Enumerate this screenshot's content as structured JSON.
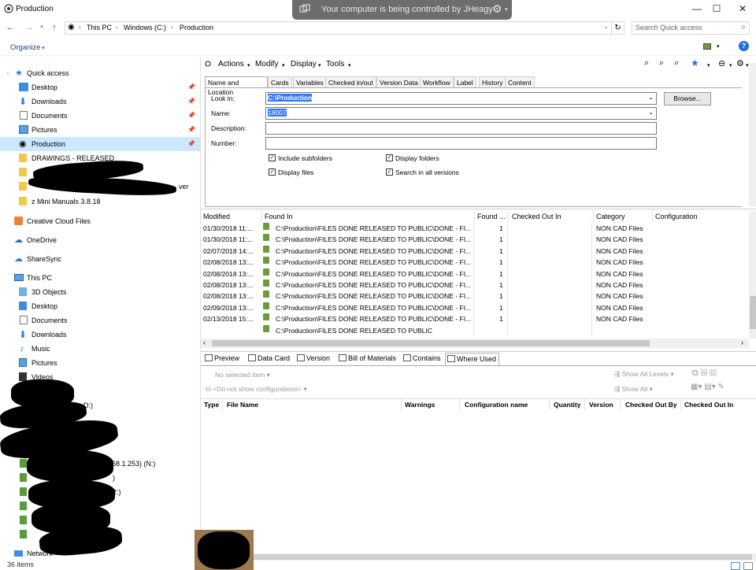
{
  "window": {
    "title": "Production",
    "control_banner": "Your computer is being controlled by JHeagy"
  },
  "address": {
    "crumbs": [
      "This PC",
      "Windows (C:)",
      "Production"
    ],
    "search_placeholder": "Search Quick access"
  },
  "toolbar": {
    "organize": "Organize"
  },
  "sidebar": {
    "quick_access": "Quick access",
    "qa_items": [
      "Desktop",
      "Downloads",
      "Documents",
      "Pictures",
      "Production",
      "DRAWINGS - RELEASED"
    ],
    "partial_overflow": "ver",
    "mini_manuals": "z Mini Manuals 3.8.18",
    "creative_cloud": "Creative Cloud Files",
    "onedrive": "OneDrive",
    "sharesync": "ShareSync",
    "this_pc": "This PC",
    "pc_items": [
      "3D Objects",
      "Desktop",
      "Documents",
      "Downloads",
      "Music",
      "Pictures",
      "Videos"
    ],
    "partial_drives": [
      ":)",
      "D:)",
      "68.1.253) (N:)",
      ")",
      "2:)"
    ],
    "network": "Network",
    "status_items": "36 items"
  },
  "vault": {
    "menu": [
      "Actions",
      "Modify",
      "Display",
      "Tools"
    ],
    "tabs": [
      "Name and Location",
      "Cards",
      "Variables",
      "Checked in/out",
      "Version Data",
      "Workflow",
      "Label",
      "History",
      "Content"
    ],
    "form": {
      "look_in_label": "Look in:",
      "look_in_value": "C:\\Production",
      "name_label": "Name:",
      "name_value": "18007",
      "description_label": "Description:",
      "number_label": "Number:",
      "browse": "Browse...",
      "include_subfolders": "Include subfolders",
      "display_folders": "Display folders",
      "display_files": "Display files",
      "search_all_versions": "Search in all versions"
    },
    "results": {
      "columns": [
        "Modified",
        "Found In",
        "Found ...",
        "Checked Out In",
        "Category",
        "Configuration"
      ],
      "rows": [
        {
          "modified": "01/30/2018 11:...",
          "found_in": "C:\\Production\\FILES DONE RELEASED TO PUBLIC\\DONE - FI...",
          "found": "1",
          "category": "NON CAD Files"
        },
        {
          "modified": "01/30/2018 11:...",
          "found_in": "C:\\Production\\FILES DONE RELEASED TO PUBLIC\\DONE - FI...",
          "found": "1",
          "category": "NON CAD Files"
        },
        {
          "modified": "02/07/2018 14:...",
          "found_in": "C:\\Production\\FILES DONE RELEASED TO PUBLIC\\DONE - FI...",
          "found": "1",
          "category": "NON CAD Files"
        },
        {
          "modified": "02/08/2018 13:...",
          "found_in": "C:\\Production\\FILES DONE RELEASED TO PUBLIC\\DONE - FI...",
          "found": "1",
          "category": "NON CAD Files"
        },
        {
          "modified": "02/08/2018 13:...",
          "found_in": "C:\\Production\\FILES DONE RELEASED TO PUBLIC\\DONE - FI...",
          "found": "1",
          "category": "NON CAD Files"
        },
        {
          "modified": "02/08/2018 13:...",
          "found_in": "C:\\Production\\FILES DONE RELEASED TO PUBLIC\\DONE - FI...",
          "found": "1",
          "category": "NON CAD Files"
        },
        {
          "modified": "02/08/2018 13:...",
          "found_in": "C:\\Production\\FILES DONE RELEASED TO PUBLIC\\DONE - FI...",
          "found": "1",
          "category": "NON CAD Files"
        },
        {
          "modified": "02/09/2018 13:...",
          "found_in": "C:\\Production\\FILES DONE RELEASED TO PUBLIC\\DONE - FI...",
          "found": "1",
          "category": "NON CAD Files"
        },
        {
          "modified": "02/13/2018 15:...",
          "found_in": "C:\\Production\\FILES DONE RELEASED TO PUBLIC\\DONE - FI...",
          "found": "1",
          "category": "NON CAD Files"
        },
        {
          "modified": "",
          "found_in": "C:\\Production\\FILES DONE RELEASED TO PUBLIC",
          "found": "",
          "category": ""
        }
      ]
    },
    "bottom_tabs": [
      "Preview",
      "Data Card",
      "Version",
      "Bill of Materials",
      "Contains",
      "Where Used"
    ],
    "where_used": {
      "no_selected": "No selected item",
      "no_configs": "<Do not show configurations>",
      "show_all_levels": "Show All Levels",
      "show_all": "Show All",
      "columns": [
        "Type",
        "File Name",
        "Warnings",
        "Configuration name",
        "Quantity",
        "Version",
        "Checked Out By",
        "Checked Out In"
      ]
    }
  },
  "colors": {
    "selection": "#cce8ff",
    "highlight": "#3377ff",
    "folder": "#f2c94c",
    "banner": "#6d6d6d"
  }
}
